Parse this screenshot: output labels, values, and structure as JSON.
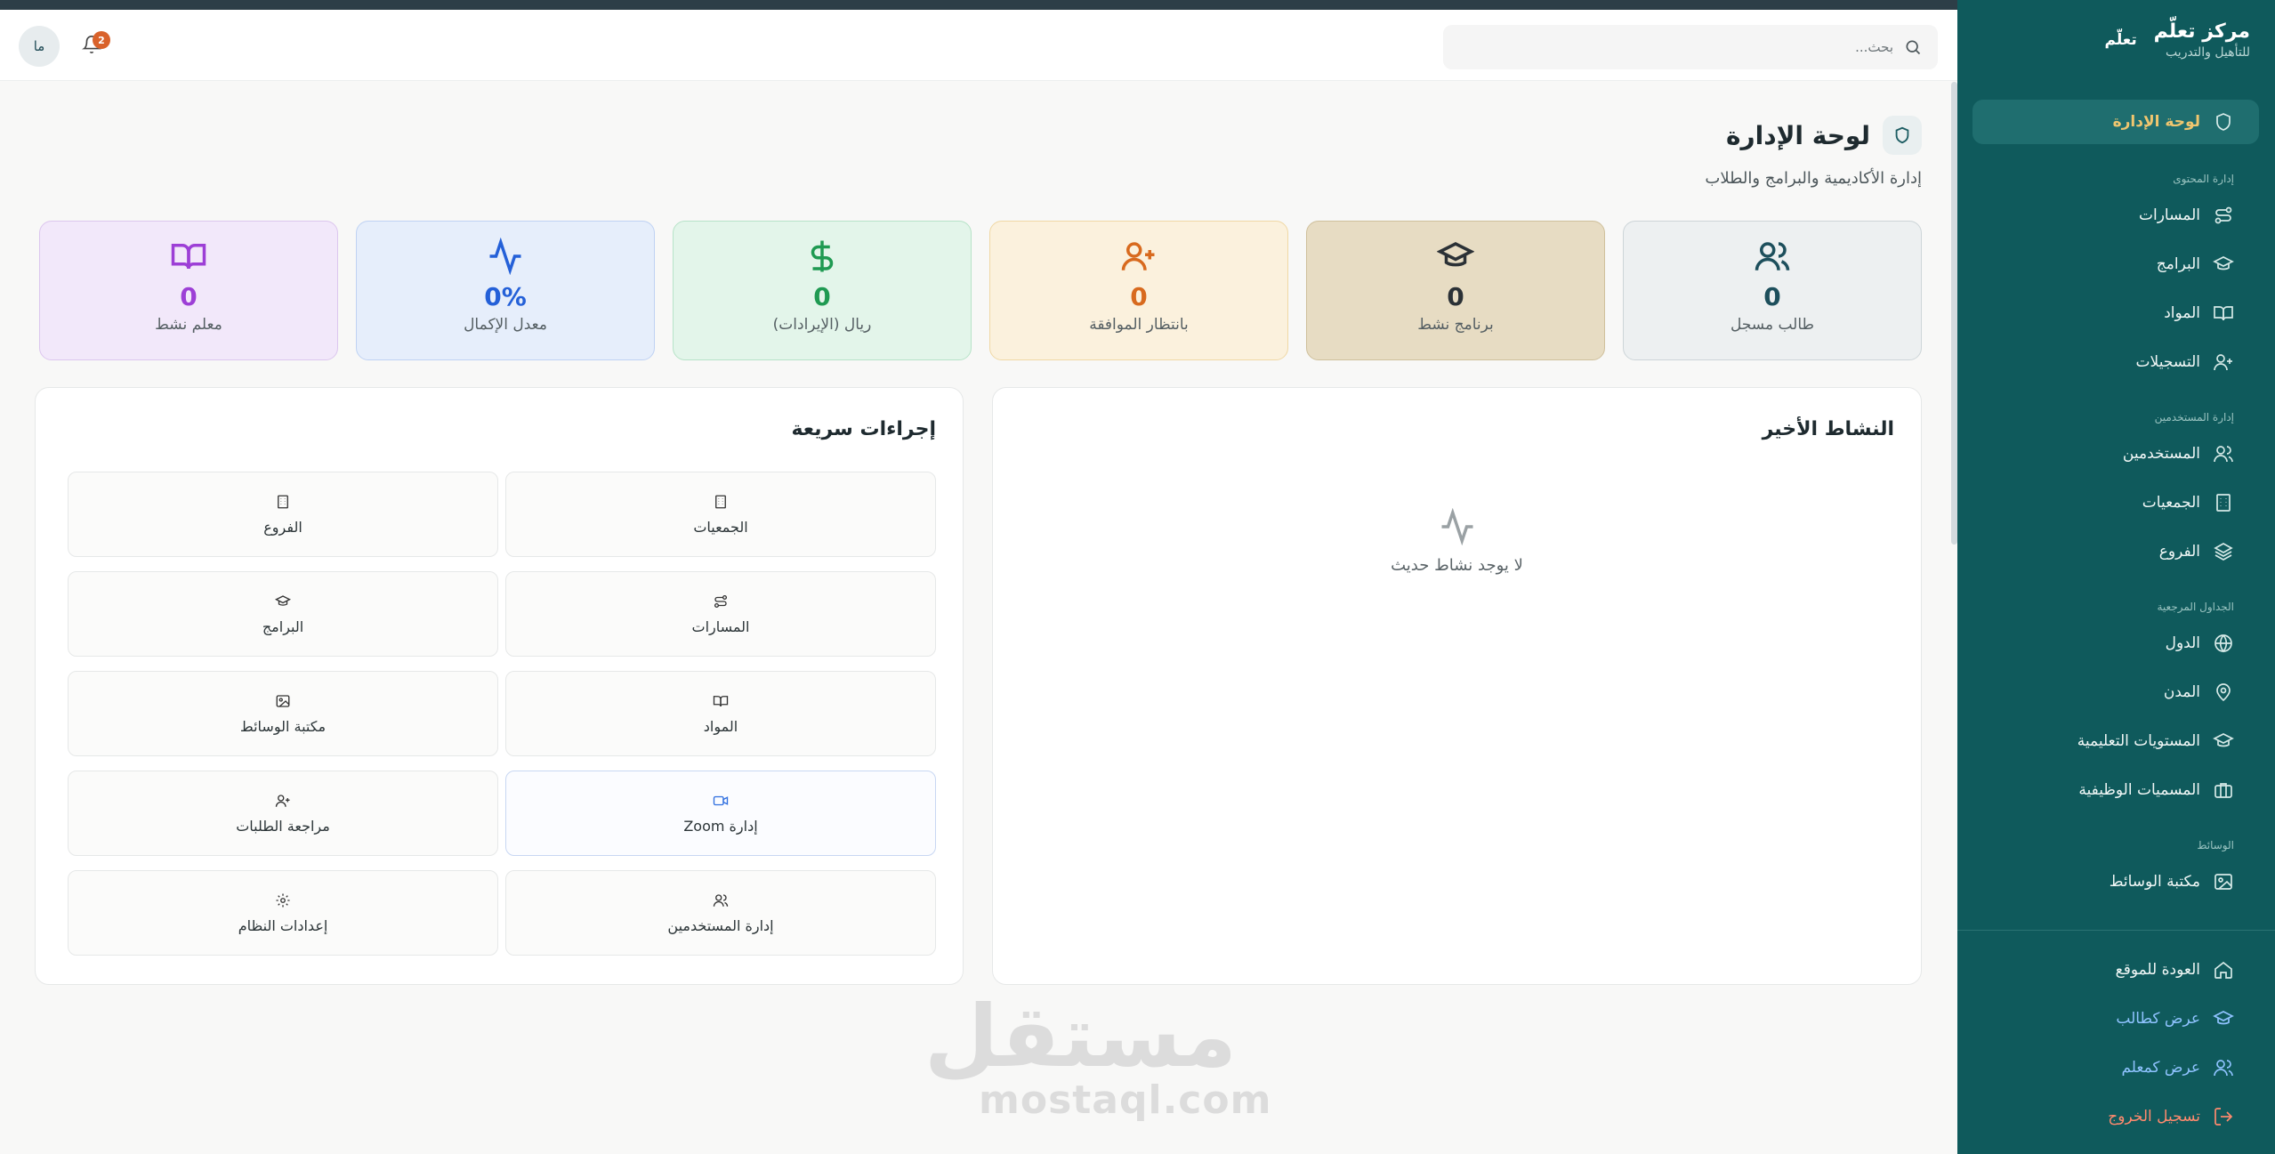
{
  "brand": {
    "name": "مركز تعلّم",
    "subtitle": "للتأهيل والتدريب",
    "logo_text": "تعلّم"
  },
  "header": {
    "search_placeholder": "بحث...",
    "notification_count": "2",
    "avatar_initials": "ما"
  },
  "sidebar": {
    "dashboard": "لوحة الإدارة",
    "groups": {
      "content": "إدارة المحتوى",
      "users": "إدارة المستخدمين",
      "reference": "الجداول المرجعية",
      "media": "الوسائط"
    },
    "content_items": [
      "المسارات",
      "البرامج",
      "المواد",
      "التسجيلات"
    ],
    "user_items": [
      "المستخدمين",
      "الجمعيات",
      "الفروع"
    ],
    "reference_items": [
      "الدول",
      "المدن",
      "المستويات التعليمية",
      "المسميات الوظيفية"
    ],
    "media_items": [
      "مكتبة الوسائط"
    ],
    "bottom": [
      "العودة للموقع",
      "عرض كطالب",
      "عرض كمعلم",
      "تسجيل الخروج"
    ]
  },
  "page": {
    "title": "لوحة الإدارة",
    "subtitle": "إدارة الأكاديمية والبرامج والطلاب"
  },
  "stats": [
    {
      "value": "0",
      "label": "طالب مسجل",
      "icon": "users-icon",
      "bg": "#edf0f1",
      "border": "#cdd5d8",
      "color": "#1d4f5c"
    },
    {
      "value": "0",
      "label": "برنامج نشط",
      "icon": "graduation-cap-icon",
      "bg": "#e7dcc3",
      "border": "#cfc09c",
      "color": "#2b3136"
    },
    {
      "value": "0",
      "label": "بانتظار الموافقة",
      "icon": "user-plus-icon",
      "bg": "#fbf1dd",
      "border": "#f0d8a5",
      "color": "#d86a1e"
    },
    {
      "value": "0",
      "label": "ريال (الإيرادات)",
      "icon": "dollar-icon",
      "bg": "#e3f5ea",
      "border": "#b7e3c8",
      "color": "#1f9a52"
    },
    {
      "value": "0%",
      "label": "معدل الإكمال",
      "icon": "activity-icon",
      "bg": "#e6eefb",
      "border": "#bfd2f3",
      "color": "#2460d8"
    },
    {
      "value": "0",
      "label": "معلم نشط",
      "icon": "book-open-icon",
      "bg": "#f2e8fa",
      "border": "#dcc6ee",
      "color": "#9d3fd6"
    }
  ],
  "activity": {
    "title": "النشاط الأخير",
    "empty_text": "لا يوجد نشاط حديث"
  },
  "quick": {
    "title": "إجراءات سريعة",
    "actions": [
      "الجمعيات",
      "الفروع",
      "المسارات",
      "البرامج",
      "المواد",
      "مكتبة الوسائط",
      "إدارة Zoom",
      "مراجعة الطلبات",
      "إدارة المستخدمين",
      "إعدادات النظام"
    ]
  },
  "watermark": {
    "arabic": "مستقل",
    "latin": "mostaql.com"
  }
}
